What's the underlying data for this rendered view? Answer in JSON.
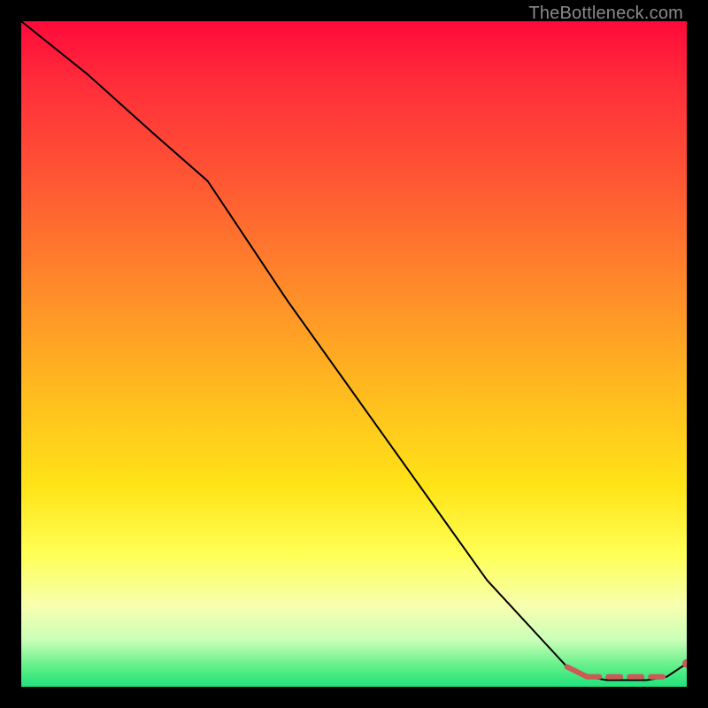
{
  "watermark": "TheBottleneck.com",
  "colors": {
    "background": "#000000",
    "curve": "#000000",
    "marker": "#cc5a57",
    "gradient_top": "#ff0a3a",
    "gradient_bottom": "#1fe27a"
  },
  "chart_data": {
    "type": "line",
    "title": "",
    "xlabel": "",
    "ylabel": "",
    "xlim": [
      0,
      100
    ],
    "ylim": [
      0,
      100
    ],
    "grid": false,
    "series": [
      {
        "name": "bottleneck-curve",
        "x": [
          0,
          10,
          20,
          28,
          40,
          55,
          70,
          82,
          85,
          88,
          91,
          94,
          97,
          100
        ],
        "y": [
          100,
          92,
          83,
          76,
          58,
          37,
          16,
          3,
          1.5,
          1,
          1,
          1,
          1.5,
          3.5
        ]
      }
    ],
    "annotations": [
      {
        "name": "highlight-descent-segment",
        "style": "solid",
        "x": [
          82,
          85
        ],
        "y": [
          3,
          1.5
        ]
      },
      {
        "name": "highlight-flat-segment",
        "style": "dashed",
        "x": [
          85,
          97
        ],
        "y": [
          1.5,
          1.5
        ]
      },
      {
        "name": "end-dot",
        "style": "point",
        "x": [
          100
        ],
        "y": [
          3.5
        ]
      }
    ]
  }
}
